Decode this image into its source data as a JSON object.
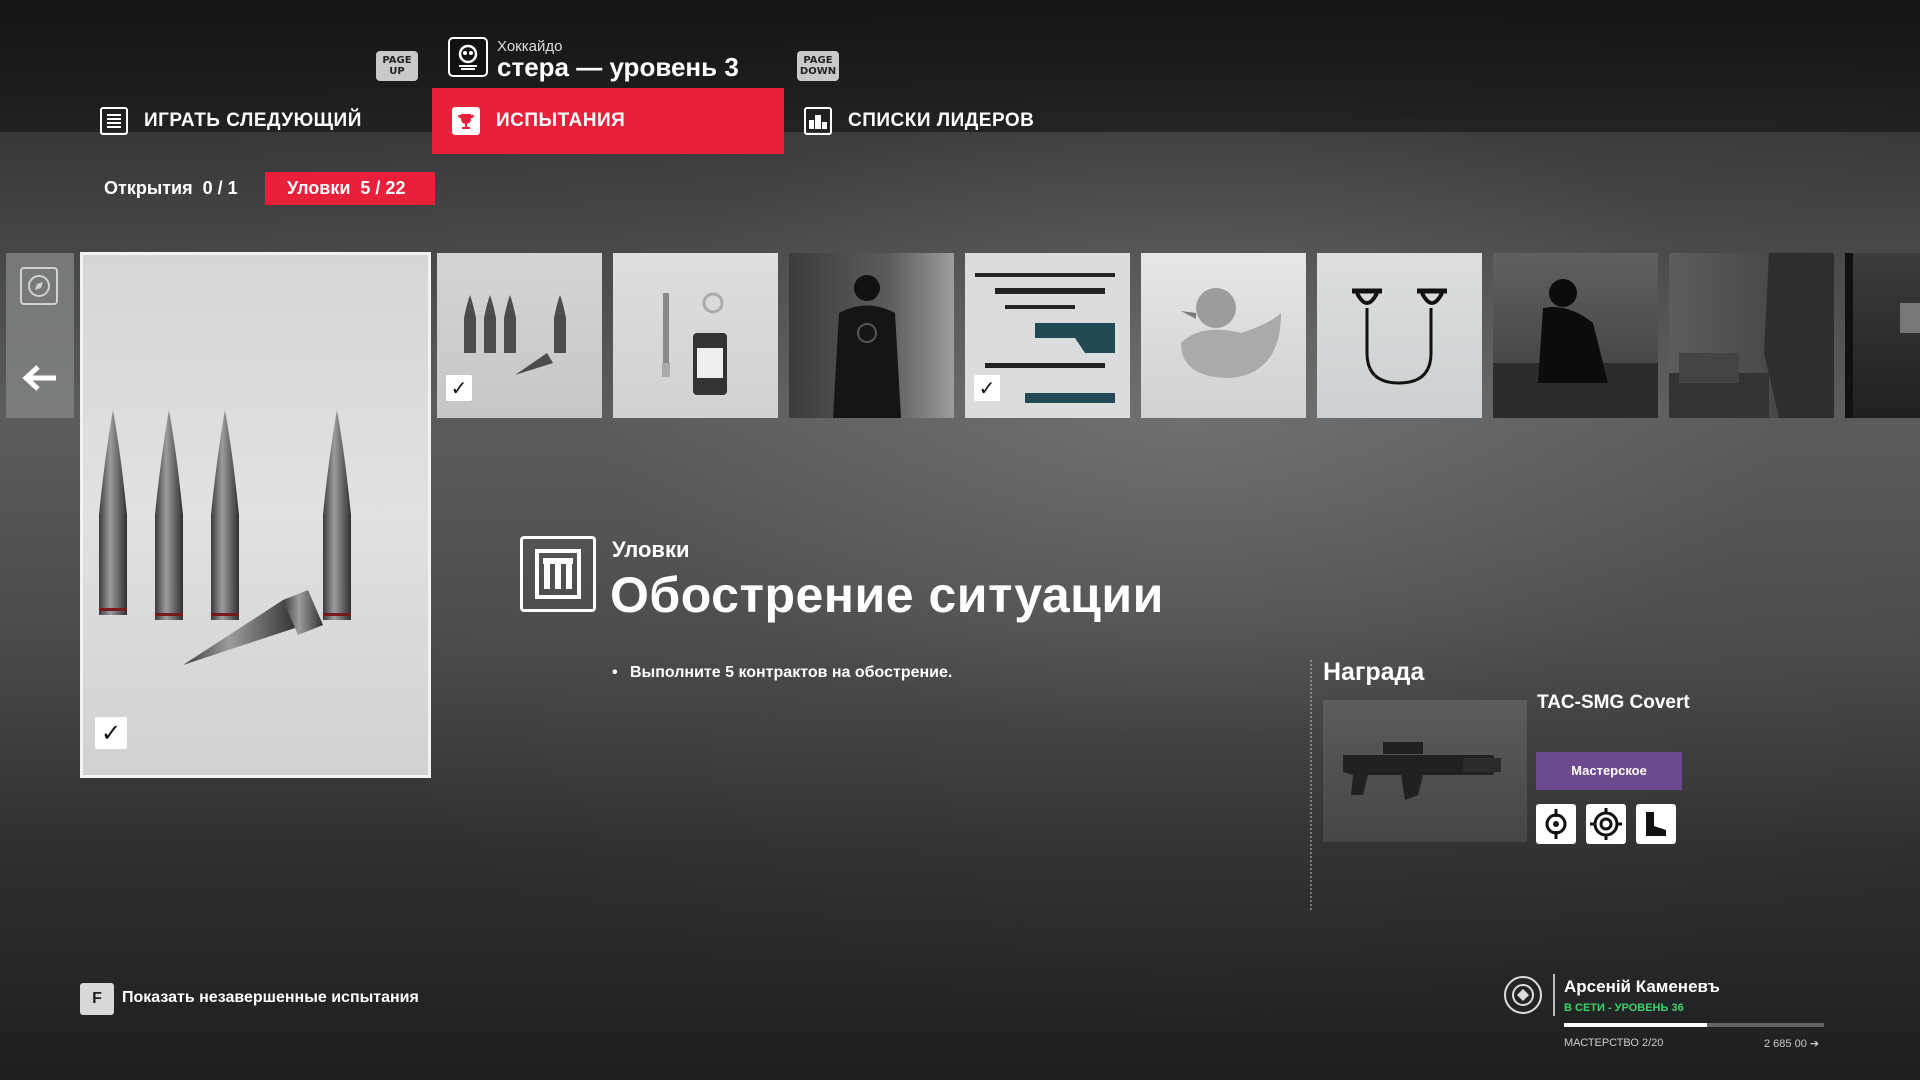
{
  "header": {
    "page_up": "PAGE UP",
    "page_down": "PAGE DOWN",
    "location_subtitle": "Хоккайдо",
    "location_title": "стера — уровень 3"
  },
  "tabs": [
    {
      "label": "ИГРАТЬ СЛЕДУЮЩИЙ",
      "icon": "list-icon",
      "active": false
    },
    {
      "label": "ИСПЫТАНИЯ",
      "icon": "trophy-icon",
      "active": true
    },
    {
      "label": "СПИСКИ ЛИДЕРОВ",
      "icon": "leaderboard-icon",
      "active": false
    }
  ],
  "filters": [
    {
      "label": "Открытия",
      "count": "0 / 1",
      "active": false
    },
    {
      "label": "Уловки",
      "count": "5 / 22",
      "active": true
    }
  ],
  "tiles": [
    {
      "name": "bullets",
      "completed": true
    },
    {
      "name": "syringe-vial",
      "completed": false
    },
    {
      "name": "agent-suit",
      "completed": false
    },
    {
      "name": "rifle-parts",
      "completed": true
    },
    {
      "name": "rubber-duck",
      "completed": false
    },
    {
      "name": "fiber-wire",
      "completed": false
    },
    {
      "name": "crouching-figure",
      "completed": false
    },
    {
      "name": "cliff-building",
      "completed": false
    },
    {
      "name": "dark-room",
      "completed": false
    }
  ],
  "selected": {
    "completed": true,
    "category": "Уловки",
    "title": "Обострение ситуации",
    "objective": "Выполните 5 контрактов на обострение."
  },
  "reward": {
    "heading": "Награда",
    "name": "TAC-SMG Covert",
    "rarity": "Мастерское",
    "rarity_color": "#6d4a8f",
    "perks": [
      "reticle-icon",
      "scope-icon",
      "boot-icon"
    ]
  },
  "footer": {
    "key": "F",
    "hint": "Показать незавершенные испытания"
  },
  "profile": {
    "name": "Арсенiй Каменевъ",
    "status": "В СЕТИ - УРОВЕНЬ 36",
    "mastery": "МАСТЕРСТВО 2/20",
    "xp": "2 685 00",
    "progress": 0.55
  },
  "colors": {
    "accent": "#e8203a",
    "online": "#3ad36a"
  }
}
